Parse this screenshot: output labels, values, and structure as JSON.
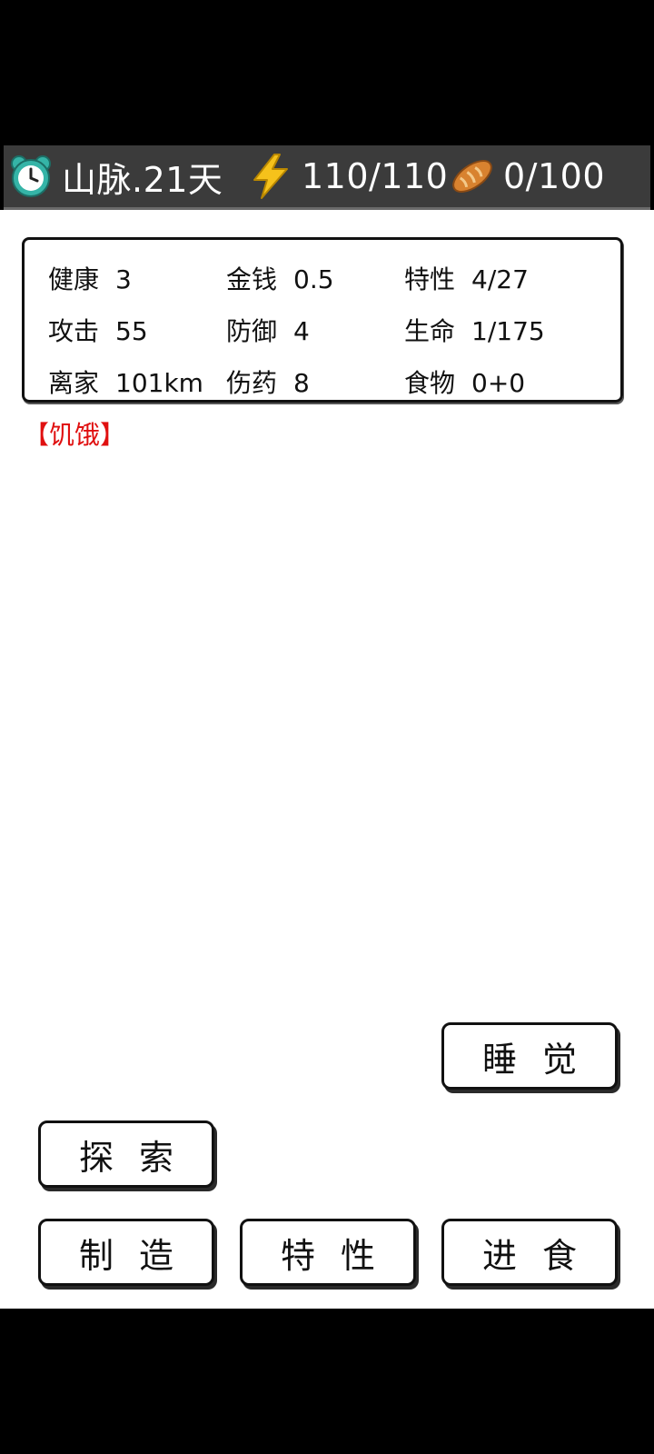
{
  "topbar": {
    "location_day": "山脉.21天",
    "energy": "110/110",
    "food": "0/100"
  },
  "stats": {
    "health": {
      "label": "健康",
      "value": "3"
    },
    "money": {
      "label": "金钱",
      "value": "0.5"
    },
    "traits": {
      "label": "特性",
      "value": "4/27"
    },
    "attack": {
      "label": "攻击",
      "value": "55"
    },
    "defense": {
      "label": "防御",
      "value": "4"
    },
    "life": {
      "label": "生命",
      "value": "1/175"
    },
    "distance": {
      "label": "离家",
      "value": "101km"
    },
    "medicine": {
      "label": "伤药",
      "value": "8"
    },
    "food": {
      "label": "食物",
      "value": "0+0"
    }
  },
  "status_effect": "【饥饿】",
  "buttons": {
    "sleep": "睡觉",
    "explore": "探索",
    "craft": "制造",
    "traits": "特性",
    "eat": "进食"
  },
  "icons": {
    "clock": "alarm-clock-icon",
    "energy": "lightning-bolt-icon",
    "food": "bread-icon"
  },
  "colors": {
    "status_red": "#e01010",
    "topbar_bg": "#3b3b3b",
    "bolt_yellow": "#f6c21b",
    "clock_teal": "#35b4a7",
    "bread_brown": "#c8742a"
  }
}
